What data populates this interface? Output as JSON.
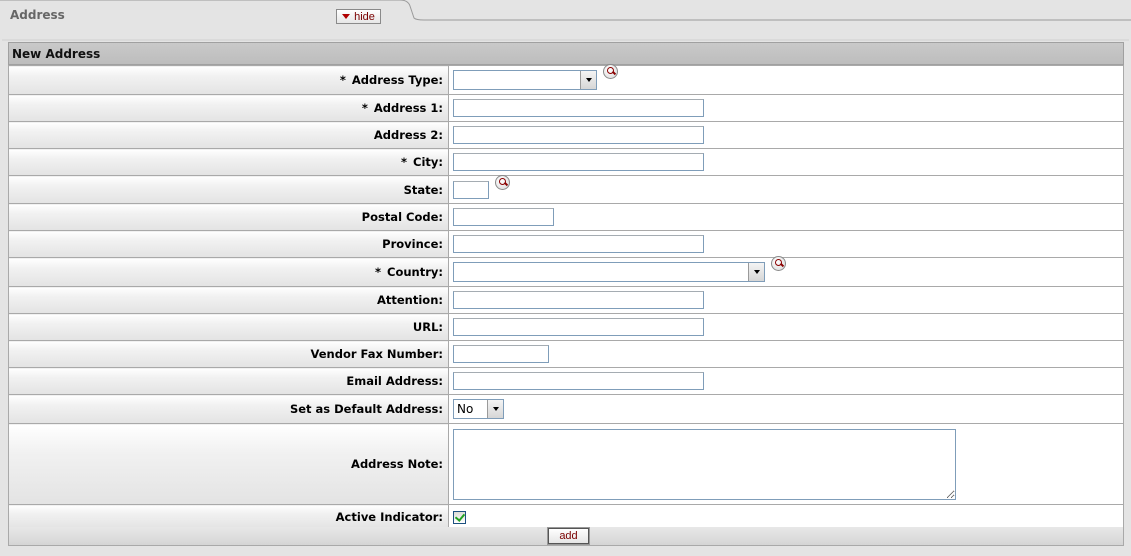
{
  "tab": {
    "title": "Address",
    "hide_label": "hide"
  },
  "panel": {
    "title": "New Address"
  },
  "fields": {
    "address_type": {
      "label": "Address Type:",
      "required": "*",
      "value": ""
    },
    "address1": {
      "label": "Address 1:",
      "required": "*",
      "value": ""
    },
    "address2": {
      "label": "Address 2:",
      "value": ""
    },
    "city": {
      "label": "City:",
      "required": "*",
      "value": ""
    },
    "state": {
      "label": "State:",
      "value": ""
    },
    "postal_code": {
      "label": "Postal Code:",
      "value": ""
    },
    "province": {
      "label": "Province:",
      "value": ""
    },
    "country": {
      "label": "Country:",
      "required": "*",
      "value": ""
    },
    "attention": {
      "label": "Attention:",
      "value": ""
    },
    "url": {
      "label": "URL:",
      "value": ""
    },
    "vendor_fax": {
      "label": "Vendor Fax Number:",
      "value": ""
    },
    "email": {
      "label": "Email Address:",
      "value": ""
    },
    "default_address": {
      "label": "Set as Default Address:",
      "value": "No"
    },
    "address_note": {
      "label": "Address Note:",
      "value": ""
    },
    "active": {
      "label": "Active Indicator:",
      "checked": true
    }
  },
  "actions": {
    "add_label": "add"
  },
  "icons": {
    "lookup": "magnifier-lookup-icon",
    "collapse": "triangle-down-icon"
  },
  "colors": {
    "button_text": "#7a0000",
    "panel_header": "#c3c3c3",
    "background": "#e4e4e4"
  }
}
